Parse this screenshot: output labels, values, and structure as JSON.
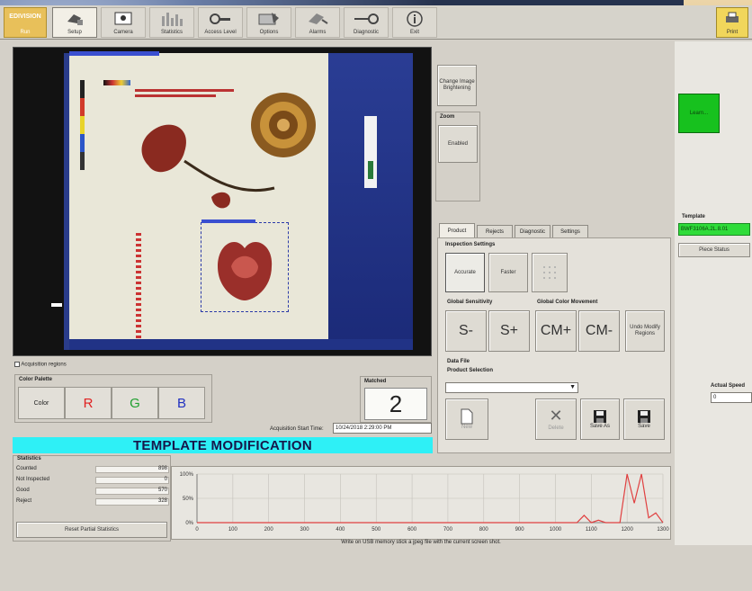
{
  "toolbar": {
    "logo": "EDIVISION",
    "logo_sub": "Run",
    "items": [
      {
        "label": "Setup"
      },
      {
        "label": "Camera"
      },
      {
        "label": "Statistics"
      },
      {
        "label": "Access Level"
      },
      {
        "label": "Options"
      },
      {
        "label": "Alarms"
      },
      {
        "label": "Diagnostic"
      },
      {
        "label": "Exit"
      }
    ],
    "print_label": "Print"
  },
  "viewer": {
    "acquisition_label": "Acquisition regions"
  },
  "side": {
    "change_image_brightening": "Change Image Brightening",
    "zoom_label": "Zoom",
    "zoom_button": "Enabled",
    "learn_button": "Learn..."
  },
  "tabs": [
    "Product",
    "Rejects",
    "Diagnostic",
    "Settings"
  ],
  "inspection": {
    "title": "Inspection Settings",
    "buttons": [
      "Accurate",
      "Faster"
    ]
  },
  "sensitivity": {
    "title": "Global Sensitivity",
    "minus": "S-",
    "plus": "S+"
  },
  "color_movement": {
    "title": "Global Color Movement",
    "plus": "CM+",
    "minus": "CM-",
    "undo": "Undo Modify Regions"
  },
  "datafile": {
    "title": "Data File",
    "product_selection": "Product Selection",
    "buttons": [
      "New",
      "Delete",
      "Save As",
      "Save"
    ]
  },
  "color_palette": {
    "title": "Color Palette",
    "first": "Color",
    "r": "R",
    "g": "G",
    "b": "B"
  },
  "matched": {
    "label": "Matched",
    "value": "2"
  },
  "acquisition": {
    "label": "Acquisition Start Time:",
    "value": "10/24/2018 2:29:00 PM"
  },
  "banner": "TEMPLATE MODIFICATION",
  "template": {
    "title": "Template",
    "value": "BWF3106A.2L.8.01",
    "button": "Piece Status"
  },
  "actual_speed": {
    "label": "Actual Speed",
    "value": "0"
  },
  "statistics": {
    "title": "Statistics",
    "rows": [
      {
        "name": "Counted",
        "value": "898"
      },
      {
        "name": "Not Inspected",
        "value": "0"
      },
      {
        "name": "Good",
        "value": "570"
      },
      {
        "name": "Reject",
        "value": "328"
      }
    ],
    "reset_button": "Reset Partial Statistics"
  },
  "chart_data": {
    "type": "line",
    "x": [
      0,
      100,
      200,
      300,
      400,
      500,
      600,
      700,
      800,
      900,
      1000,
      1060,
      1080,
      1100,
      1120,
      1140,
      1160,
      1180,
      1200,
      1220,
      1240,
      1260,
      1280,
      1300
    ],
    "y": [
      0,
      0,
      0,
      0,
      0,
      0,
      0,
      0,
      0,
      0,
      0,
      0,
      15,
      0,
      5,
      0,
      0,
      0,
      100,
      40,
      100,
      10,
      20,
      0
    ],
    "x_ticks": [
      "0",
      "100",
      "200",
      "300",
      "400",
      "500",
      "600",
      "700",
      "800",
      "900",
      "1000",
      "1100",
      "1200",
      "1300"
    ],
    "y_ticks": [
      "100%",
      "50%",
      "0%"
    ],
    "xlim": [
      0,
      1300
    ],
    "ylim": [
      0,
      100
    ],
    "color": "#e04040"
  },
  "footer_note": "Write on USB memory stick a jpeg file with the current screen shot."
}
